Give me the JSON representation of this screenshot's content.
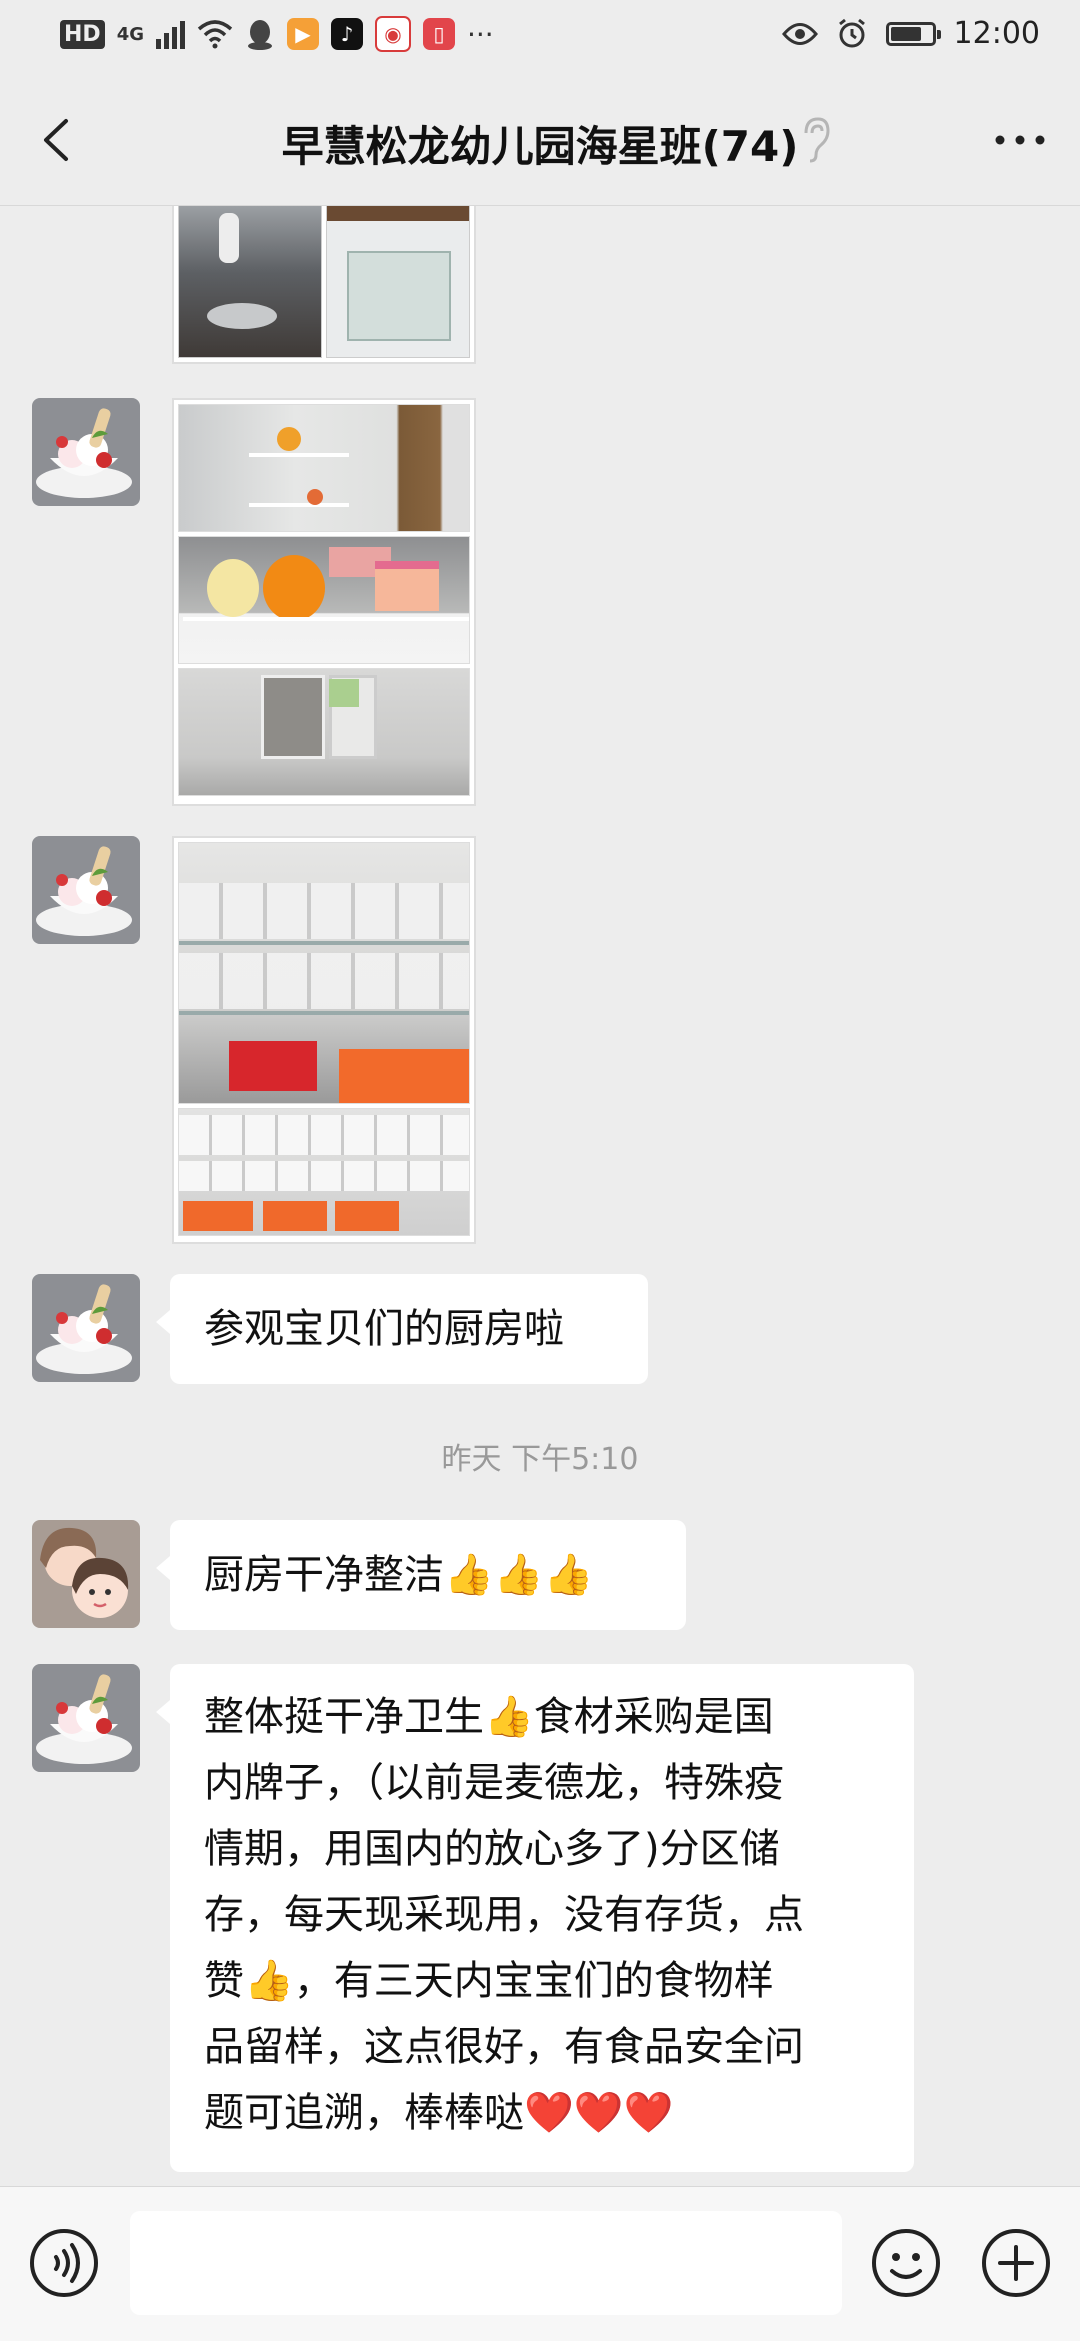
{
  "status_bar": {
    "hd": "HD",
    "network": "4G",
    "time": "12:00",
    "battery_level": 0.75,
    "apps": [
      "ingot-icon",
      "video-play-icon",
      "tiktok-icon",
      "weibo-icon",
      "book-icon"
    ],
    "more": "···"
  },
  "nav": {
    "title": "早慧松龙幼儿园海星班(74)"
  },
  "messages": [
    {
      "type": "image",
      "sender": "avatar-icecream",
      "count": 2
    },
    {
      "type": "image",
      "sender": "avatar-icecream",
      "count": 3
    },
    {
      "type": "image",
      "sender": "avatar-icecream",
      "count": 2
    },
    {
      "type": "text",
      "sender": "avatar-icecream",
      "text": "参观宝贝们的厨房啦"
    },
    {
      "type": "time",
      "text": "昨天 下午5:10"
    },
    {
      "type": "text",
      "sender": "avatar-girl",
      "text": "厨房干净整洁👍👍👍"
    },
    {
      "type": "text",
      "sender": "avatar-icecream",
      "lines": [
        "整体挺干净卫生👍食材采购是国",
        "内牌子，（以前是麦德龙，特殊疫",
        "情期，用国内的放心多了)分区储",
        "存，每天现采现用，没有存货，点",
        "赞👍，有三天内宝宝们的食物样",
        "品留样，这点很好，有食品安全问",
        "题可追溯，棒棒哒❤️❤️❤️"
      ]
    }
  ],
  "colors": {
    "background": "#ededed",
    "bubble": "#ffffff",
    "timestamp": "#999999"
  }
}
